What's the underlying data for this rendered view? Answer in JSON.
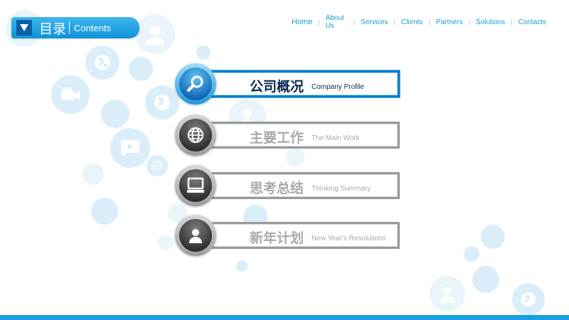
{
  "header": {
    "title_zh": "目录",
    "title_en": "Contents"
  },
  "nav": {
    "items": [
      "Home",
      "About Us",
      "Services",
      "Clients",
      "Partners",
      "Solutions",
      "Contacts"
    ]
  },
  "menu": {
    "items": [
      {
        "zh": "公司概况",
        "en": "Company Profile",
        "icon": "search-icon",
        "active": true
      },
      {
        "zh": "主要工作",
        "en": "The Main Work",
        "icon": "globe-icon",
        "active": false
      },
      {
        "zh": "思考总结",
        "en": "Thinking Summary",
        "icon": "computer-icon",
        "active": false
      },
      {
        "zh": "新年计划",
        "en": "New Year's Resolutions",
        "icon": "user-icon",
        "active": false
      }
    ]
  },
  "colors": {
    "accent": "#1a9fe0",
    "active_text": "#0b2a4e",
    "inactive_text": "#a9a9a9"
  }
}
